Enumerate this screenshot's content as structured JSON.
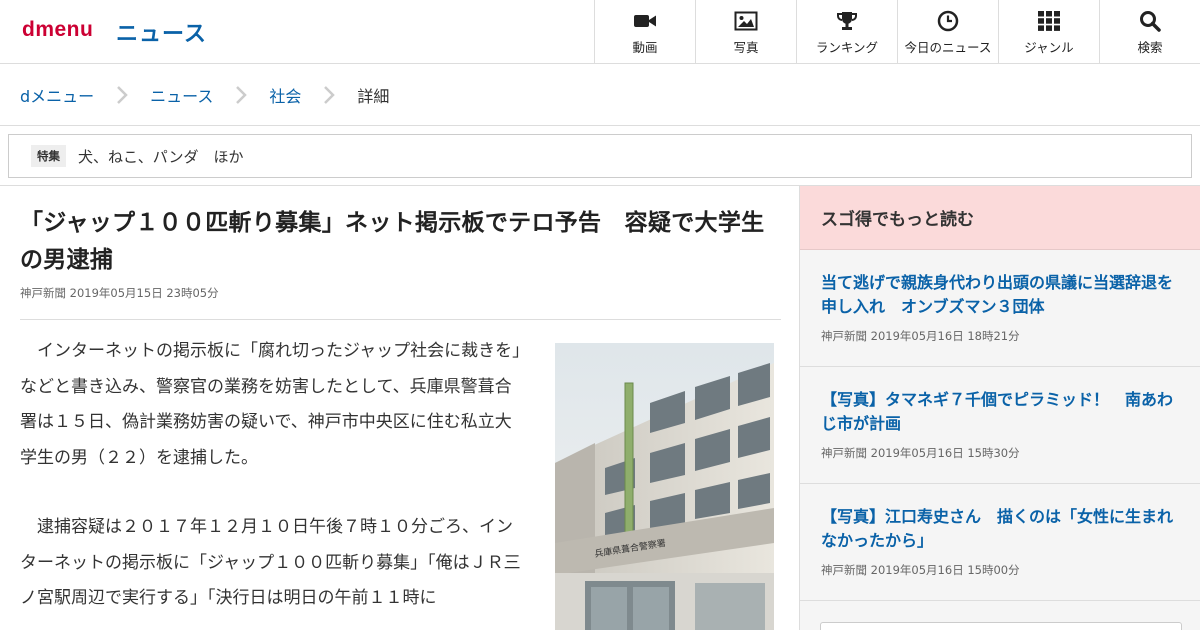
{
  "header": {
    "logo": "dmenu",
    "section": "ニュース",
    "nav": [
      {
        "label": "動画",
        "icon": "video-camera-icon"
      },
      {
        "label": "写真",
        "icon": "photo-icon"
      },
      {
        "label": "ランキング",
        "icon": "trophy-icon"
      },
      {
        "label": "今日のニュース",
        "icon": "clock-icon"
      },
      {
        "label": "ジャンル",
        "icon": "grid-icon"
      },
      {
        "label": "検索",
        "icon": "search-icon"
      }
    ]
  },
  "breadcrumb": [
    "dメニュー",
    "ニュース",
    "社会",
    "詳細"
  ],
  "feature": {
    "badge": "特集",
    "text": "犬、ねこ、パンダ　ほか"
  },
  "article": {
    "title": "「ジャップ１００匹斬り募集」ネット掲示板でテロ予告　容疑で大学生の男逮捕",
    "source": "神戸新聞",
    "date": "2019年05月15日",
    "time": "23時05分",
    "paragraphs": [
      "インターネットの掲示板に「腐れ切ったジャップ社会に裁きを」などと書き込み、警察官の業務を妨害したとして、兵庫県警葺合署は１５日、偽計業務妨害の疑いで、神戸市中央区に住む私立大学生の男（２２）を逮捕した。",
      "逮捕容疑は２０１７年１２月１０日午後７時１０分ごろ、インターネットの掲示板に「ジャップ１００匹斬り募集」「俺はＪＲ三ノ宮駅周辺で実行する」「決行日は明日の午前１１時に"
    ],
    "photo": {
      "building_sign": "兵庫県葺合警察署"
    }
  },
  "sidebar": {
    "heading": "スゴ得でもっと読む",
    "items": [
      {
        "title": "当て逃げで親族身代わり出頭の県議に当選辞退を申し入れ　オンブズマン３団体",
        "source": "神戸新聞",
        "date": "2019年05月16日",
        "time": "18時21分"
      },
      {
        "title": "【写真】タマネギ７千個でピラミッド！　南あわじ市が計画",
        "source": "神戸新聞",
        "date": "2019年05月16日",
        "time": "15時30分"
      },
      {
        "title": "【写真】江口寿史さん　描くのは「女性に生まれなかったから」",
        "source": "神戸新聞",
        "date": "2019年05月16日",
        "time": "15時00分"
      }
    ]
  },
  "colors": {
    "brand": "#cc0033",
    "link": "#0a62a8",
    "sidebar_head": "#fbdada"
  }
}
